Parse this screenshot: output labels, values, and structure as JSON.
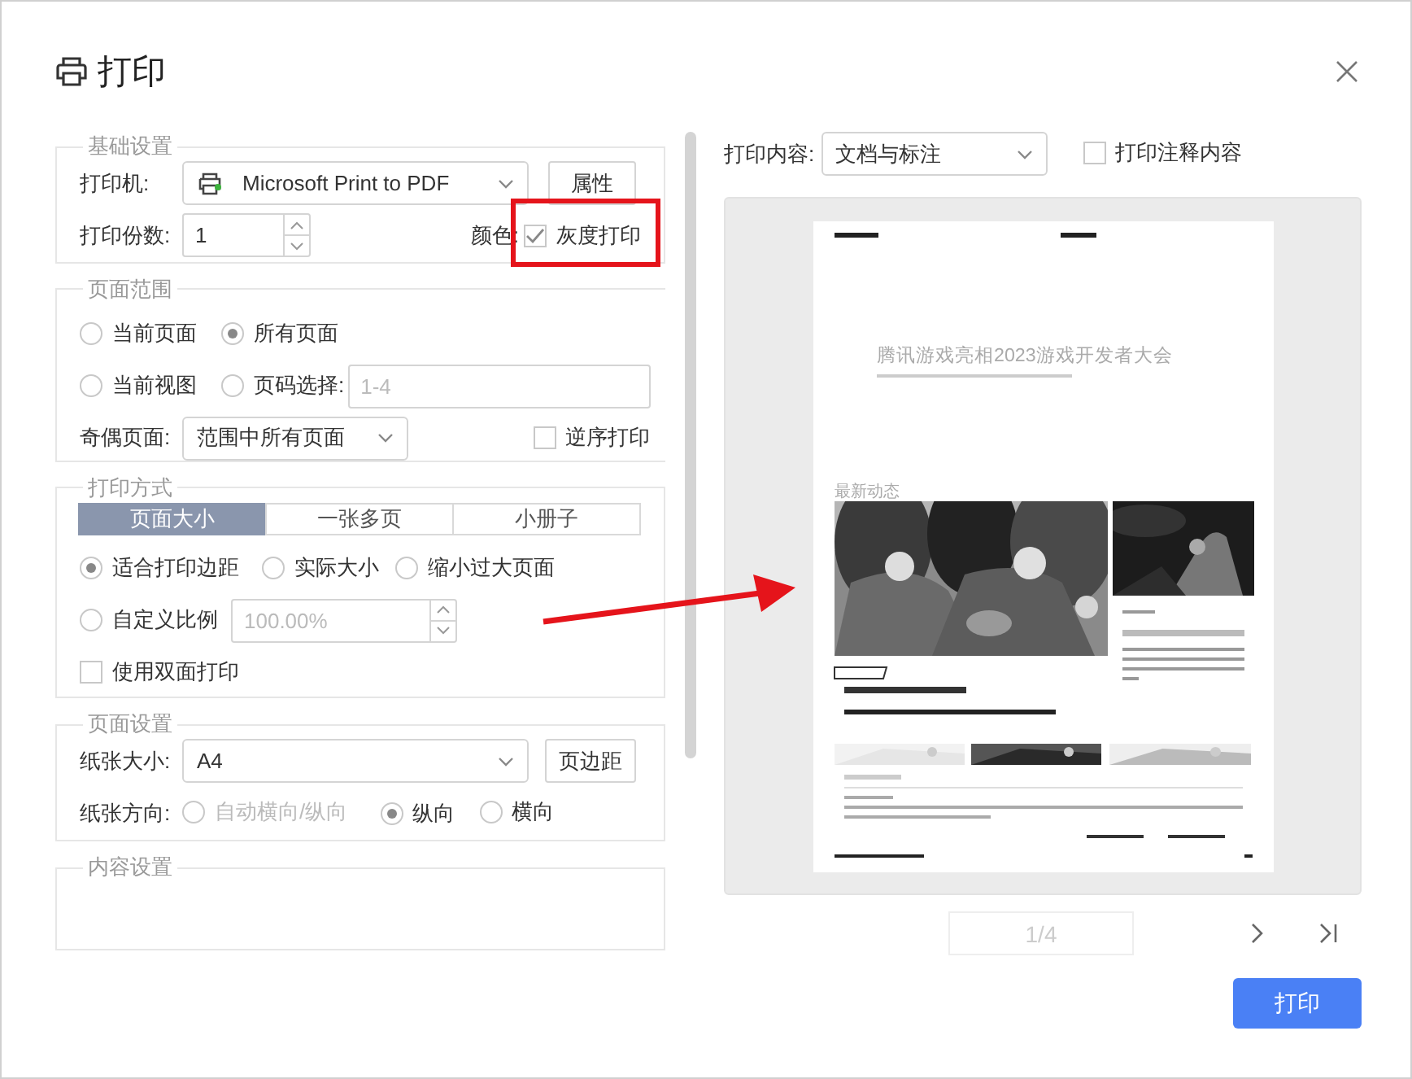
{
  "window": {
    "title": "打印"
  },
  "basic": {
    "legend": "基础设置",
    "printer_label": "打印机:",
    "printer": "Microsoft Print to PDF",
    "properties_button": "属性",
    "copies_label": "打印份数:",
    "copies": "1",
    "color_label": "颜色:",
    "grayscale": {
      "label": "灰度打印",
      "checked": true
    }
  },
  "range": {
    "legend": "页面范围",
    "options": [
      {
        "label": "当前页面",
        "selected": false
      },
      {
        "label": "所有页面",
        "selected": true
      },
      {
        "label": "当前视图",
        "selected": false
      },
      {
        "label": "页码选择:",
        "selected": false
      }
    ],
    "pages": {
      "placeholder": "1-4"
    },
    "odd_even_label": "奇偶页面:",
    "odd_even": "范围中所有页面",
    "reverse": {
      "label": "逆序打印",
      "checked": false
    }
  },
  "mode": {
    "legend": "打印方式",
    "tabs": [
      {
        "label": "页面大小",
        "selected": true
      },
      {
        "label": "一张多页",
        "selected": false
      },
      {
        "label": "小册子",
        "selected": false
      }
    ],
    "scaling": [
      {
        "label": "适合打印边距",
        "selected": true
      },
      {
        "label": "实际大小",
        "selected": false
      },
      {
        "label": "缩小过大页面",
        "selected": false
      },
      {
        "label": "自定义比例",
        "selected": false
      }
    ],
    "scale": {
      "value": "100.00%",
      "disabled": true
    },
    "duplex": {
      "label": "使用双面打印",
      "checked": false
    }
  },
  "page_setup": {
    "legend": "页面设置",
    "paper_label": "纸张大小:",
    "paper": "A4",
    "margins_button": "页边距",
    "orientation_label": "纸张方向:",
    "orientations": [
      {
        "label": "自动横向/纵向",
        "selected": false,
        "disabled": true
      },
      {
        "label": "纵向",
        "selected": true,
        "disabled": false
      },
      {
        "label": "横向",
        "selected": false,
        "disabled": false
      }
    ]
  },
  "content_settings": {
    "legend": "内容设置"
  },
  "preview": {
    "content_label": "打印内容:",
    "content": "文档与标注",
    "print_comments": {
      "label": "打印注释内容",
      "checked": false
    },
    "page": {
      "title": "腾讯游戏亮相2023游戏开发者大会",
      "section": "最新动态"
    },
    "page_indicator": "1/4"
  },
  "print_button": "打印"
}
